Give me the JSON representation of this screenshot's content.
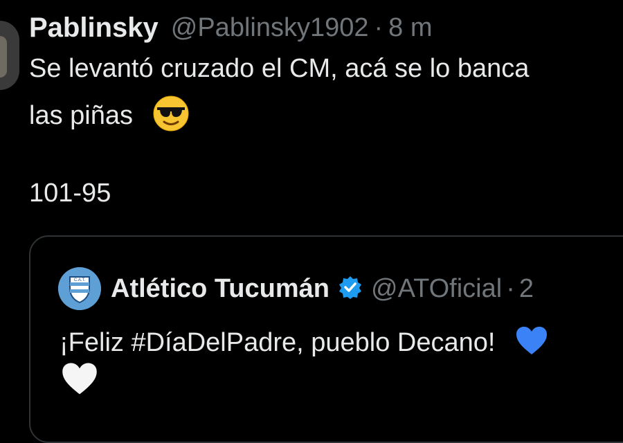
{
  "tweet": {
    "author_name": "Pablinsky",
    "author_handle": "@Pablinsky1902",
    "separator": "·",
    "time": "8 m",
    "line1": "Se levantó cruzado el CM, acá se lo banca",
    "line2": "las piñas",
    "line2_emoji": "smiling-face-with-sunglasses-icon",
    "line3": "101-95"
  },
  "quoted_tweet": {
    "author_name": "Atlético Tucumán",
    "verified": true,
    "author_handle": "@ATOficial",
    "separator": "·",
    "time": "2",
    "logo_text": "C.A.T.",
    "line1": "¡Feliz #DíaDelPadre, pueblo Decano!",
    "line1_emoji": "blue-heart-icon",
    "line2_emoji": "white-heart-icon"
  },
  "colors": {
    "background": "#000000",
    "text": "#e7e9ea",
    "secondary_text": "#71767b",
    "border": "#2f3336",
    "verified_blue": "#1d9bf0",
    "blue_heart": "#3b82f6"
  }
}
